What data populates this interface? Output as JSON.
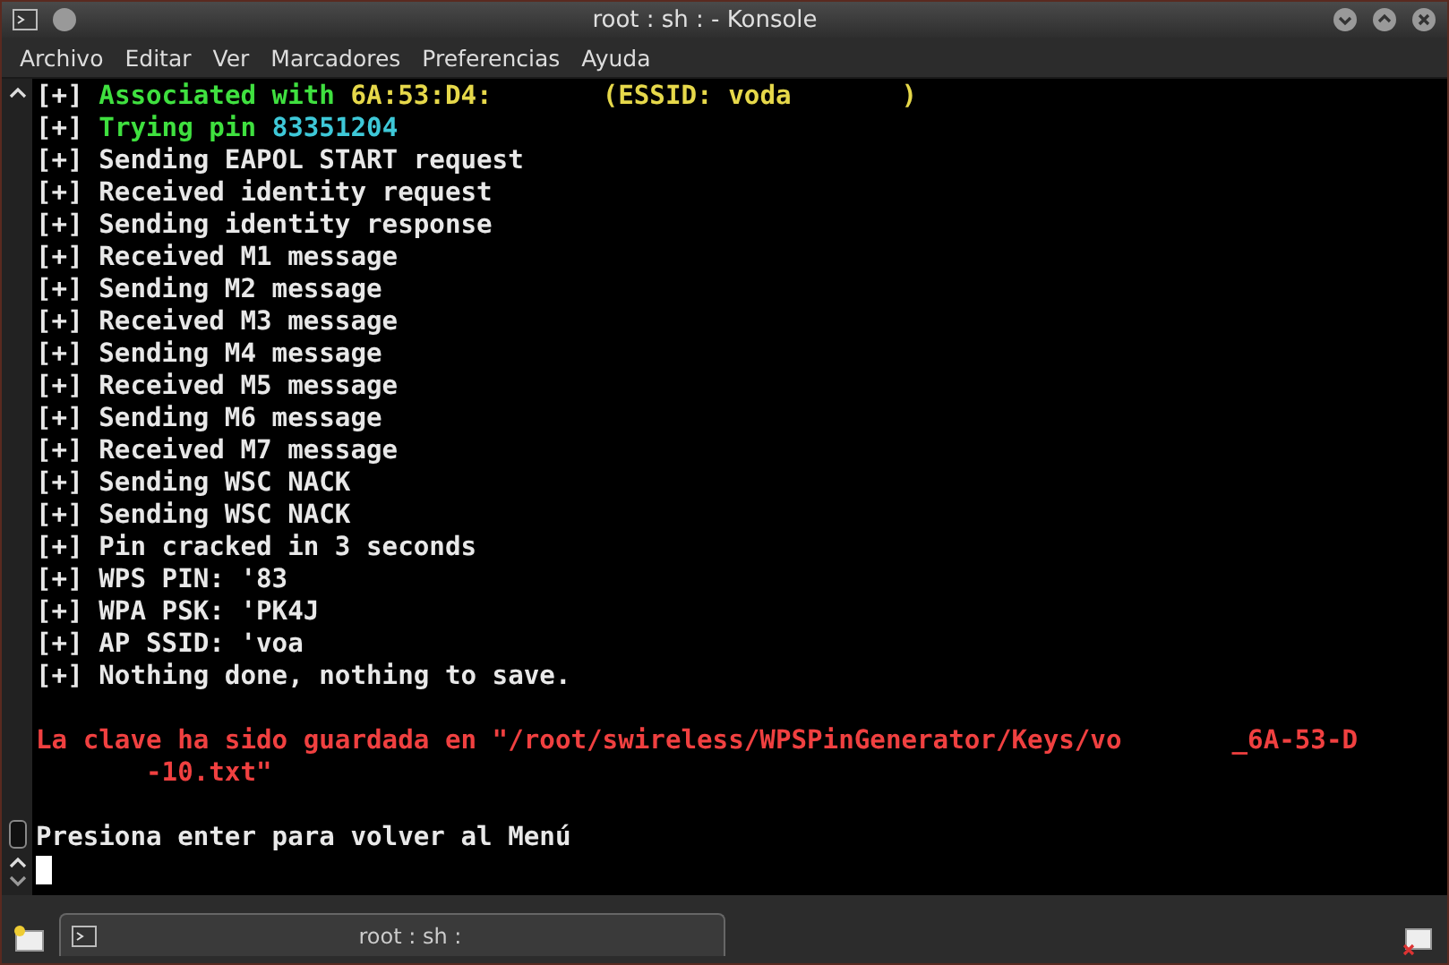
{
  "window": {
    "title": "root : sh :  - Konsole"
  },
  "menu": [
    "Archivo",
    "Editar",
    "Ver",
    "Marcadores",
    "Preferencias",
    "Ayuda"
  ],
  "terminal": {
    "lines": [
      {
        "kind": "output",
        "segments": [
          {
            "text": "[+] ",
            "color": "#e8e8e8"
          },
          {
            "text": "Associated with ",
            "color": "#3fe03f"
          },
          {
            "text": "6A:53:D4:",
            "color": "#e6d84a"
          },
          {
            "text": "(ESSID: voda",
            "color": "#e6d84a",
            "gap_before": true
          },
          {
            "text": ")",
            "color": "#e6d84a",
            "gap_before": true
          }
        ]
      },
      {
        "kind": "output",
        "segments": [
          {
            "text": "[+] ",
            "color": "#e8e8e8"
          },
          {
            "text": "Trying pin ",
            "color": "#3fe03f"
          },
          {
            "text": "83351204",
            "color": "#3ec8d8"
          }
        ]
      },
      {
        "kind": "output",
        "segments": [
          {
            "text": "[+] Sending EAPOL START request",
            "color": "#e8e8e8"
          }
        ]
      },
      {
        "kind": "output",
        "segments": [
          {
            "text": "[+] Received identity request",
            "color": "#e8e8e8"
          }
        ]
      },
      {
        "kind": "output",
        "segments": [
          {
            "text": "[+] Sending identity response",
            "color": "#e8e8e8"
          }
        ]
      },
      {
        "kind": "output",
        "segments": [
          {
            "text": "[+] Received M1 message",
            "color": "#e8e8e8"
          }
        ]
      },
      {
        "kind": "output",
        "segments": [
          {
            "text": "[+] Sending M2 message",
            "color": "#e8e8e8"
          }
        ]
      },
      {
        "kind": "output",
        "segments": [
          {
            "text": "[+] Received M3 message",
            "color": "#e8e8e8"
          }
        ]
      },
      {
        "kind": "output",
        "segments": [
          {
            "text": "[+] Sending M4 message",
            "color": "#e8e8e8"
          }
        ]
      },
      {
        "kind": "output",
        "segments": [
          {
            "text": "[+] Received M5 message",
            "color": "#e8e8e8"
          }
        ]
      },
      {
        "kind": "output",
        "segments": [
          {
            "text": "[+] Sending M6 message",
            "color": "#e8e8e8"
          }
        ]
      },
      {
        "kind": "output",
        "segments": [
          {
            "text": "[+] Received M7 message",
            "color": "#e8e8e8"
          }
        ]
      },
      {
        "kind": "output",
        "segments": [
          {
            "text": "[+] Sending WSC NACK",
            "color": "#e8e8e8"
          }
        ]
      },
      {
        "kind": "output",
        "segments": [
          {
            "text": "[+] Sending WSC NACK",
            "color": "#e8e8e8"
          }
        ]
      },
      {
        "kind": "output",
        "segments": [
          {
            "text": "[+] Pin cracked in 3 seconds",
            "color": "#e8e8e8"
          }
        ]
      },
      {
        "kind": "output",
        "segments": [
          {
            "text": "[+] WPS PIN: '83",
            "color": "#e8e8e8"
          }
        ]
      },
      {
        "kind": "output",
        "segments": [
          {
            "text": "[+] WPA PSK: 'PK4J",
            "color": "#e8e8e8"
          }
        ]
      },
      {
        "kind": "output",
        "segments": [
          {
            "text": "[+] AP SSID: 'voa",
            "color": "#e8e8e8"
          }
        ]
      },
      {
        "kind": "output",
        "segments": [
          {
            "text": "[+] Nothing done, nothing to save.",
            "color": "#e8e8e8"
          }
        ]
      },
      {
        "kind": "blank"
      },
      {
        "kind": "output",
        "segments": [
          {
            "text": "La clave ha sido guardada en \"/root/swireless/WPSPinGenerator/Keys/vo",
            "color": "#f04040"
          },
          {
            "text": "_6A-53-D",
            "color": "#f04040",
            "gap_before": true
          }
        ]
      },
      {
        "kind": "output",
        "segments": [
          {
            "text": "-10.txt\"",
            "color": "#f04040",
            "gap_before": true
          }
        ]
      },
      {
        "kind": "blank"
      },
      {
        "kind": "output",
        "segments": [
          {
            "text": "Presiona enter para volver al Menú",
            "color": "#e8e8e8"
          }
        ]
      }
    ]
  },
  "tab": {
    "label": "root : sh :",
    "selected": true
  }
}
